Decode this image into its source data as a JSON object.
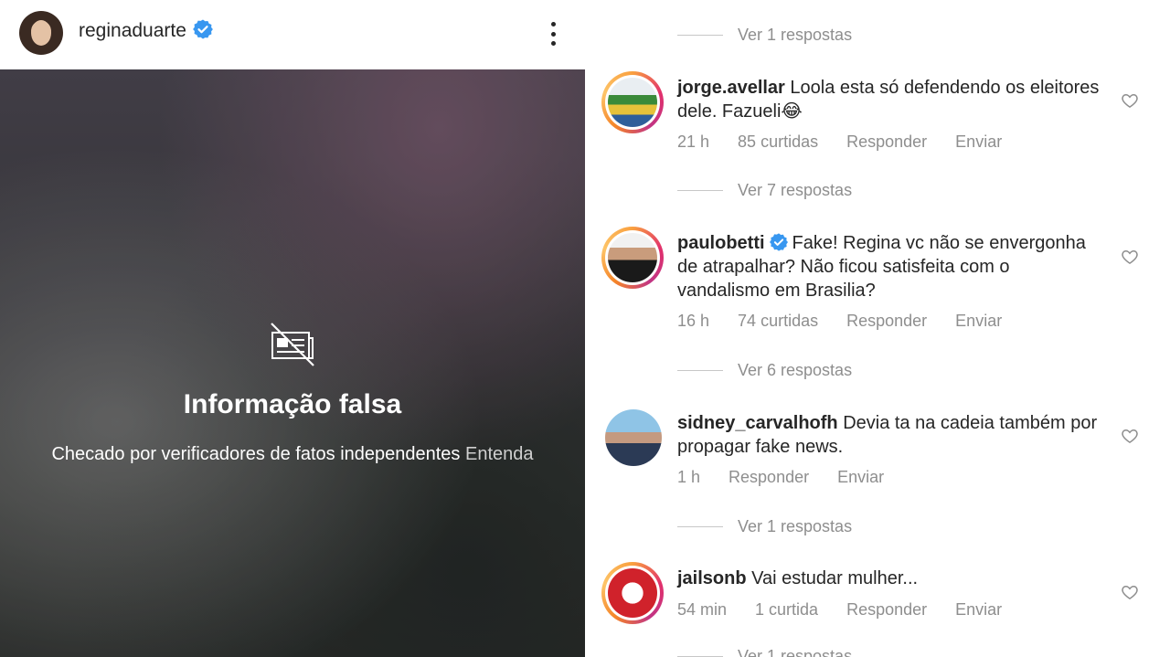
{
  "post": {
    "username": "reginaduarte",
    "verified": true
  },
  "media": {
    "warning_title": "Informação falsa",
    "warning_subtitle": "Checado por verificadores de fatos independentes",
    "warning_link": "Entenda",
    "icon": "crossed-out-news-icon"
  },
  "comments": [
    {
      "replies_label": "Ver 1 respostas"
    },
    {
      "username": "jorge.avellar",
      "verified": false,
      "text": "Loola esta só defendendo os eleitores dele. Fazueli😂",
      "time": "21 h",
      "likes": "85 curtidas",
      "reply_label": "Responder",
      "send_label": "Enviar",
      "replies_label": "Ver 7 respostas"
    },
    {
      "username": "paulobetti",
      "verified": true,
      "text": "Fake! Regina vc não se envergonha de atrapalhar? Não ficou satisfeita com o vandalismo em Brasilia?",
      "time": "16 h",
      "likes": "74 curtidas",
      "reply_label": "Responder",
      "send_label": "Enviar",
      "replies_label": "Ver 6 respostas"
    },
    {
      "username": "sidney_carvalhofh",
      "verified": false,
      "text": "Devia ta na cadeia também por propagar fake news.",
      "time": "1 h",
      "likes": "",
      "reply_label": "Responder",
      "send_label": "Enviar",
      "replies_label": "Ver 1 respostas"
    },
    {
      "username": "jailsonb",
      "verified": false,
      "text": "Vai estudar mulher...",
      "time": "54 min",
      "likes": "1 curtida",
      "reply_label": "Responder",
      "send_label": "Enviar",
      "replies_label": "Ver 1 respostas"
    }
  ],
  "colors": {
    "verified_blue": "#3897f0",
    "meta_gray": "#8e8e8e",
    "text": "#262626"
  }
}
